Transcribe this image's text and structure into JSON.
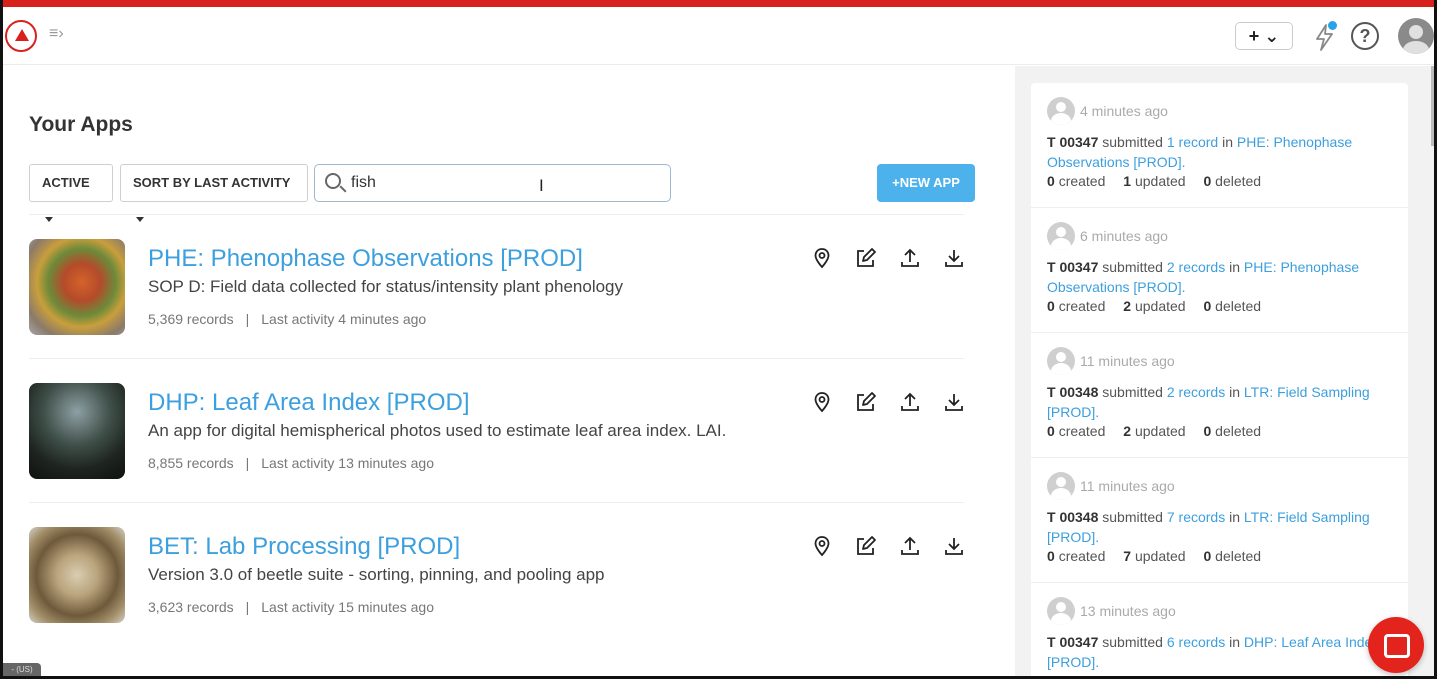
{
  "header": {
    "menu_glyph": "≡›",
    "add_label": "+ ⌄",
    "help_label": "?"
  },
  "main": {
    "title": "Your Apps",
    "filters": {
      "status_label": "ACTIVE",
      "sort_label": "SORT BY LAST ACTIVITY"
    },
    "search": {
      "value": "fish",
      "placeholder": ""
    },
    "new_app_label": "+NEW APP",
    "apps": [
      {
        "title": "PHE: Phenophase Observations [PROD]",
        "description": "SOP D: Field data collected for status/intensity plant phenology",
        "records": "5,369 records",
        "last_activity": "Last activity 4 minutes ago"
      },
      {
        "title": "DHP: Leaf Area Index [PROD]",
        "description": "An app for digital hemispherical photos used to estimate leaf area index. LAI.",
        "records": "8,855 records",
        "last_activity": "Last activity 13 minutes ago"
      },
      {
        "title": "BET: Lab Processing [PROD]",
        "description": "Version 3.0 of beetle suite - sorting, pinning, and pooling app",
        "records": "3,623 records",
        "last_activity": "Last activity 15 minutes ago"
      }
    ]
  },
  "feed": [
    {
      "time": "4 minutes ago",
      "user": "T 00347",
      "verb": "submitted",
      "records_link": "1 record",
      "in": "in",
      "app_link": "PHE: Phenophase Observations [PROD]",
      "created": "0",
      "updated": "1",
      "deleted": "0"
    },
    {
      "time": "6 minutes ago",
      "user": "T 00347",
      "verb": "submitted",
      "records_link": "2 records",
      "in": "in",
      "app_link": "PHE: Phenophase Observations [PROD]",
      "created": "0",
      "updated": "2",
      "deleted": "0"
    },
    {
      "time": "11 minutes ago",
      "user": "T 00348",
      "verb": "submitted",
      "records_link": "2 records",
      "in": "in",
      "app_link": "LTR: Field Sampling [PROD]",
      "created": "0",
      "updated": "2",
      "deleted": "0"
    },
    {
      "time": "11 minutes ago",
      "user": "T 00348",
      "verb": "submitted",
      "records_link": "7 records",
      "in": "in",
      "app_link": "LTR: Field Sampling [PROD]",
      "created": "0",
      "updated": "7",
      "deleted": "0"
    },
    {
      "time": "13 minutes ago",
      "user": "T 00347",
      "verb": "submitted",
      "records_link": "6 records",
      "in": "in",
      "app_link": "DHP: Leaf Area Index [PROD]",
      "created": "",
      "updated": "",
      "deleted": ""
    }
  ],
  "labels": {
    "created": "created",
    "updated": "updated",
    "deleted": "deleted"
  },
  "corner_badge": "- (US)",
  "colors": {
    "brand_red": "#d8211d",
    "link_blue": "#3c9fde",
    "button_blue": "#4db1ec",
    "notification_dot": "#29a3e8"
  },
  "icons": [
    "logo-icon",
    "menu-icon",
    "plus-icon",
    "chevron-down-icon",
    "lightning-icon",
    "help-icon",
    "user-avatar-icon",
    "search-icon",
    "map-pin-icon",
    "edit-icon",
    "upload-icon",
    "download-icon",
    "chat-icon"
  ]
}
